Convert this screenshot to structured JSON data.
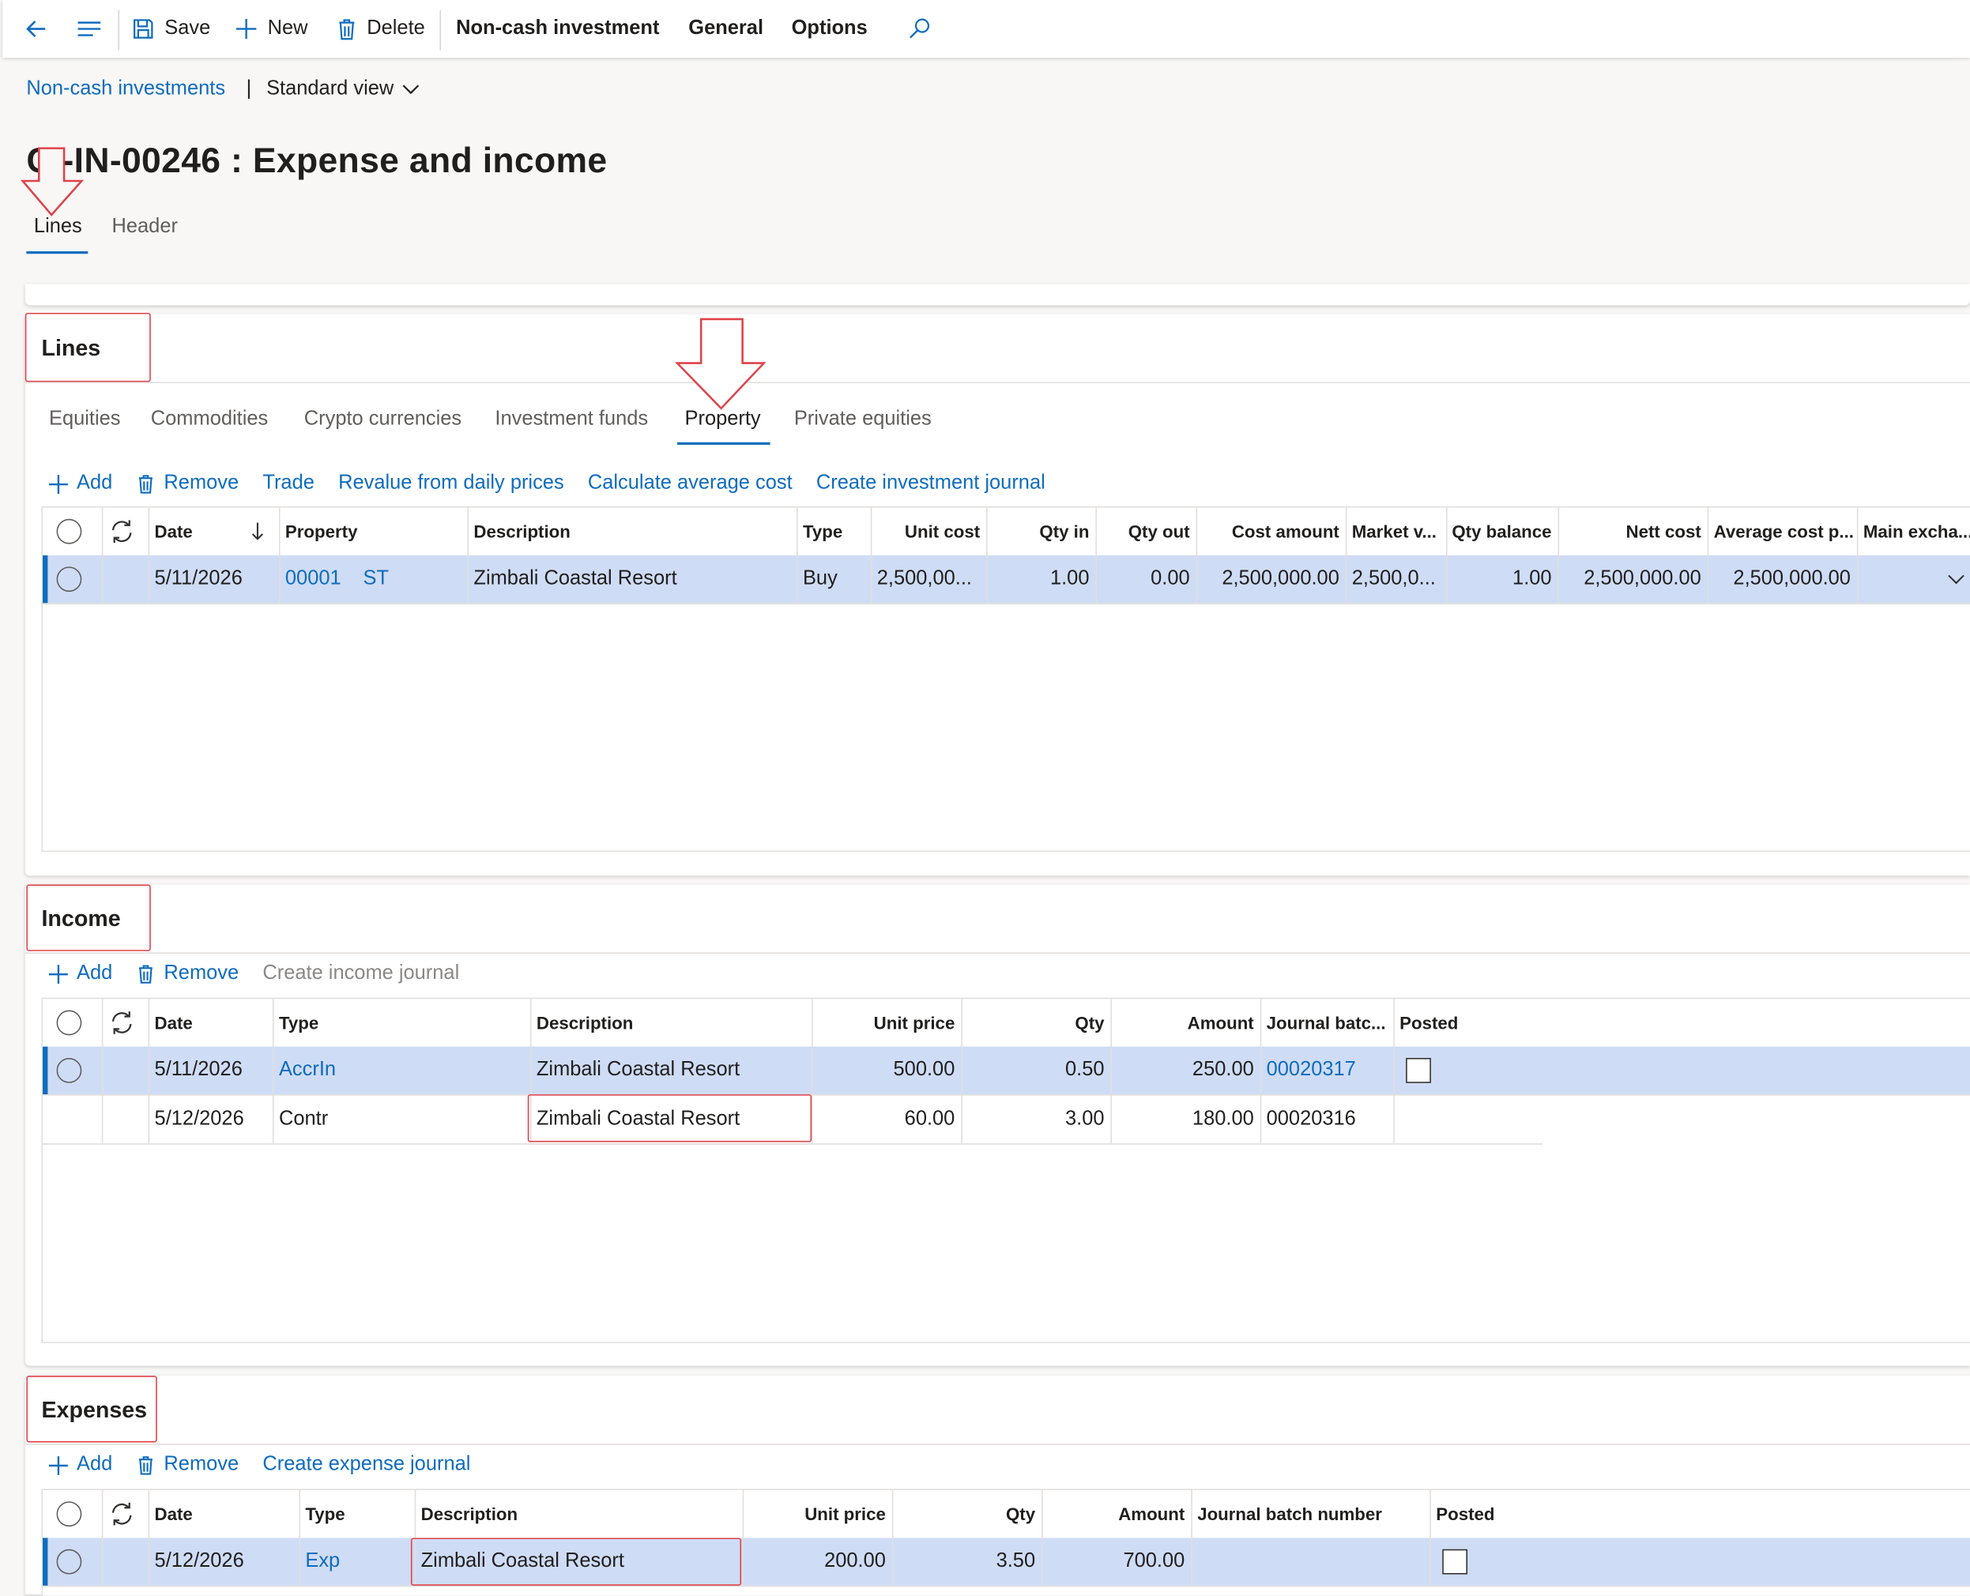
{
  "toolbar": {
    "save": "Save",
    "new": "New",
    "delete": "Delete",
    "menus": [
      "Non-cash investment",
      "General",
      "Options"
    ]
  },
  "breadcrumb": {
    "link": "Non-cash investments",
    "separator": "|",
    "view": "Standard view"
  },
  "page_title": "C -IN-00246 : Expense and income",
  "page_tabs": [
    {
      "label": "Lines",
      "active": true
    },
    {
      "label": "Header",
      "active": false
    }
  ],
  "lines": {
    "title": "Lines",
    "tabs": [
      "Equities",
      "Commodities",
      "Crypto currencies",
      "Investment funds",
      "Property",
      "Private equities"
    ],
    "active_tab": "Property",
    "actions": {
      "add": "Add",
      "remove": "Remove",
      "links": [
        "Trade",
        "Revalue from daily prices",
        "Calculate average cost",
        "Create investment journal"
      ]
    },
    "columns": [
      "Date",
      "Property",
      "Description",
      "Type",
      "Unit cost",
      "Qty in",
      "Qty out",
      "Cost amount",
      "Market v...",
      "Qty balance",
      "Nett cost",
      "Average cost p...",
      "Main excha..."
    ],
    "rows": [
      {
        "date": "5/11/2026",
        "property": "00001",
        "property_sub": "ST",
        "description": "Zimbali Coastal Resort",
        "type": "Buy",
        "unit_cost": "2,500,00...",
        "qty_in": "1.00",
        "qty_out": "0.00",
        "cost_amount": "2,500,000.00",
        "market_value": "2,500,0...",
        "qty_balance": "1.00",
        "nett_cost": "2,500,000.00",
        "average_cost": "2,500,000.00"
      }
    ]
  },
  "income": {
    "title": "Income",
    "actions": {
      "add": "Add",
      "remove": "Remove",
      "journal": "Create income journal"
    },
    "columns": [
      "Date",
      "Type",
      "Description",
      "Unit price",
      "Qty",
      "Amount",
      "Journal batc...",
      "Posted"
    ],
    "rows": [
      {
        "date": "5/11/2026",
        "type": "AccrIn",
        "description": "Zimbali Coastal Resort",
        "unit_price": "500.00",
        "qty": "0.50",
        "amount": "250.00",
        "journal": "00020317"
      },
      {
        "date": "5/12/2026",
        "type": "Contr",
        "description": "Zimbali Coastal Resort",
        "unit_price": "60.00",
        "qty": "3.00",
        "amount": "180.00",
        "journal": "00020316"
      }
    ]
  },
  "expenses": {
    "title": "Expenses",
    "actions": {
      "add": "Add",
      "remove": "Remove",
      "journal": "Create expense journal"
    },
    "columns": [
      "Date",
      "Type",
      "Description",
      "Unit price",
      "Qty",
      "Amount",
      "Journal batch number",
      "Posted"
    ],
    "rows": [
      {
        "date": "5/12/2026",
        "type": "Exp",
        "description": "Zimbali Coastal Resort",
        "unit_price": "200.00",
        "qty": "3.50",
        "amount": "700.00",
        "journal": ""
      }
    ]
  },
  "colors": {
    "accent": "#0f6cbd",
    "selected_row": "#cfdcf5",
    "annotation": "#e0424a"
  }
}
